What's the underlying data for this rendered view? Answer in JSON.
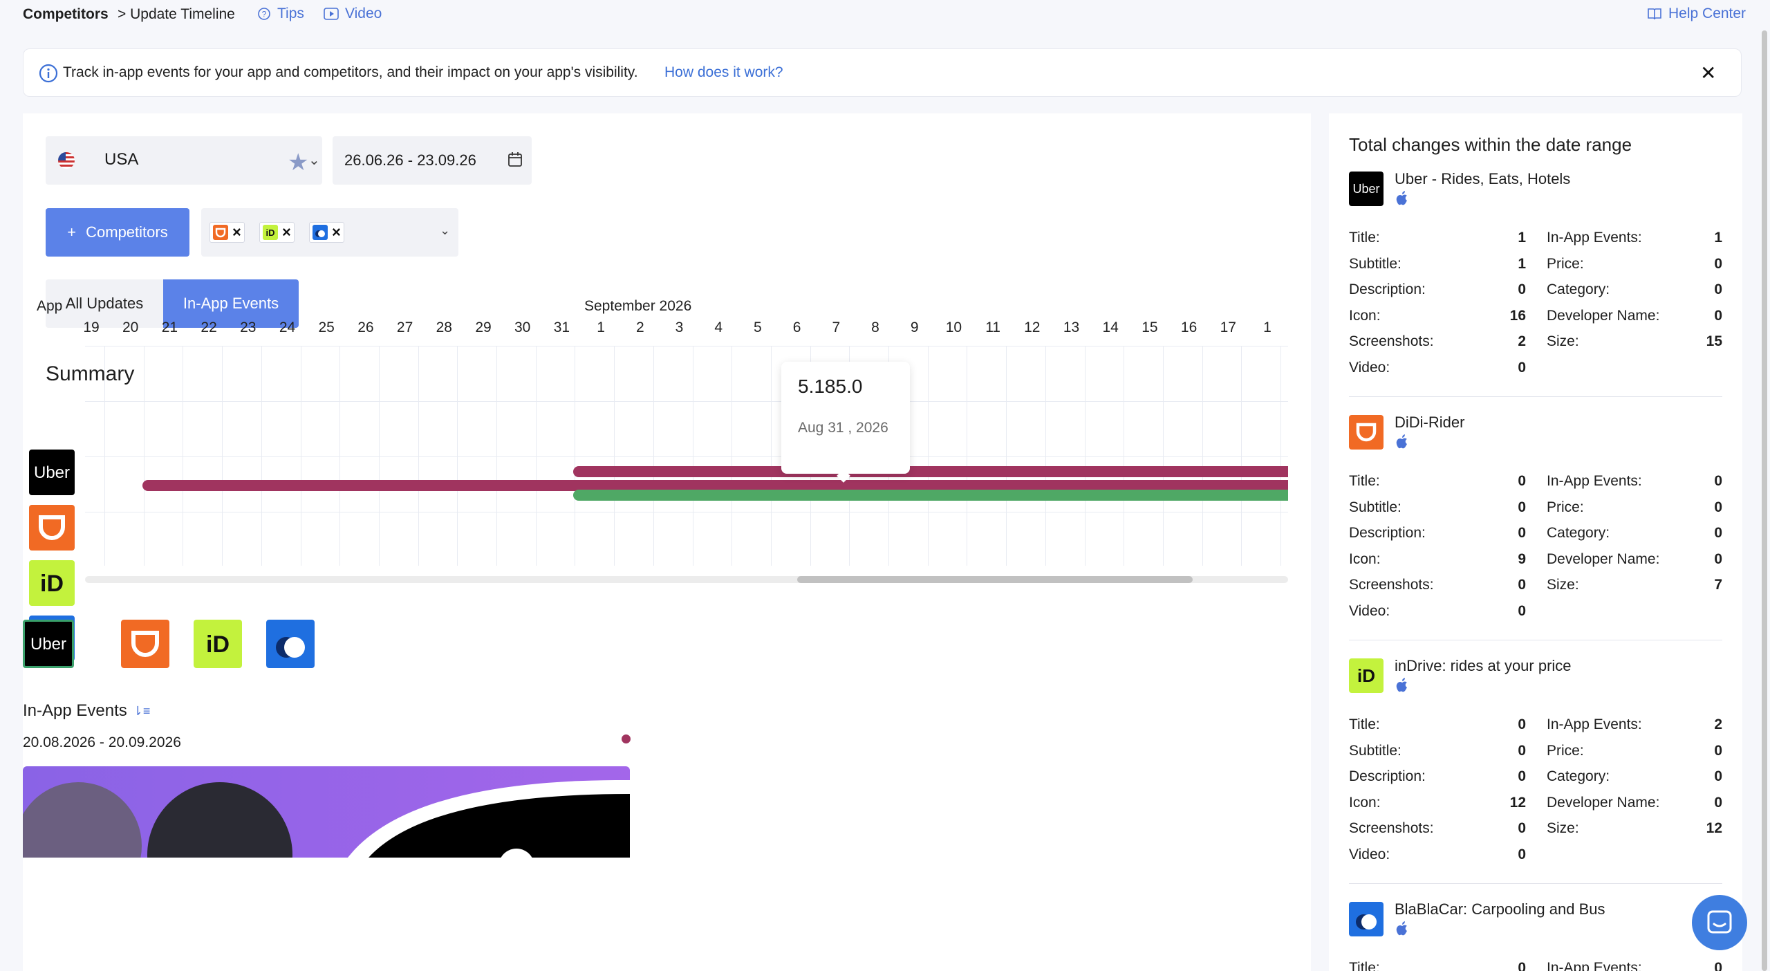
{
  "breadcrumb": {
    "root": "Competitors",
    "current": "> Update Timeline"
  },
  "links": {
    "tips": "Tips",
    "video": "Video",
    "help": "Help Center"
  },
  "banner": {
    "text": "Track in-app events for your app and competitors, and their impact on your app's visibility.",
    "link": "How does it work?",
    "close": "✕"
  },
  "filters": {
    "country": "USA",
    "date_range": "26.06.26 - 23.09.26",
    "competitors_button": "Competitors",
    "competitors_plus": "+"
  },
  "tabs": {
    "all": "All Updates",
    "inapp": "In-App Events",
    "active": "inapp"
  },
  "summary": {
    "title": "Summary",
    "app_label": "App",
    "month_label": "September 2026",
    "days": [
      "19",
      "20",
      "21",
      "22",
      "23",
      "24",
      "25",
      "26",
      "27",
      "28",
      "29",
      "30",
      "31",
      "1",
      "2",
      "3",
      "4",
      "5",
      "6",
      "7",
      "8",
      "9",
      "10",
      "11",
      "12",
      "13",
      "14",
      "15",
      "16",
      "17",
      "1"
    ],
    "tooltip": {
      "value": "5.185.0",
      "date": "Aug 31 , 2026"
    },
    "colors": {
      "update": "#a0345f",
      "event": "#4fa865"
    }
  },
  "inapp": {
    "title": "In-App Events",
    "range": "20.08.2026 - 20.09.2026"
  },
  "sidebar": {
    "title": "Total changes within the date range",
    "apps": [
      {
        "name": "Uber - Rides, Eats, Hotels",
        "icon": "uber-icon",
        "left": [
          [
            "Title:",
            "1"
          ],
          [
            "Subtitle:",
            "1"
          ],
          [
            "Description:",
            "0"
          ],
          [
            "Icon:",
            "16"
          ],
          [
            "Screenshots:",
            "2"
          ],
          [
            "Video:",
            "0"
          ]
        ],
        "right": [
          [
            "In-App Events:",
            "1"
          ],
          [
            "Price:",
            "0"
          ],
          [
            "Category:",
            "0"
          ],
          [
            "Developer Name:",
            "0"
          ],
          [
            "Size:",
            "15"
          ]
        ]
      },
      {
        "name": "DiDi-Rider",
        "icon": "didi-icon",
        "left": [
          [
            "Title:",
            "0"
          ],
          [
            "Subtitle:",
            "0"
          ],
          [
            "Description:",
            "0"
          ],
          [
            "Icon:",
            "9"
          ],
          [
            "Screenshots:",
            "0"
          ],
          [
            "Video:",
            "0"
          ]
        ],
        "right": [
          [
            "In-App Events:",
            "0"
          ],
          [
            "Price:",
            "0"
          ],
          [
            "Category:",
            "0"
          ],
          [
            "Developer Name:",
            "0"
          ],
          [
            "Size:",
            "7"
          ]
        ]
      },
      {
        "name": "inDrive: rides at your price",
        "icon": "indrive-icon",
        "left": [
          [
            "Title:",
            "0"
          ],
          [
            "Subtitle:",
            "0"
          ],
          [
            "Description:",
            "0"
          ],
          [
            "Icon:",
            "12"
          ],
          [
            "Screenshots:",
            "0"
          ],
          [
            "Video:",
            "0"
          ]
        ],
        "right": [
          [
            "In-App Events:",
            "2"
          ],
          [
            "Price:",
            "0"
          ],
          [
            "Category:",
            "0"
          ],
          [
            "Developer Name:",
            "0"
          ],
          [
            "Size:",
            "12"
          ]
        ]
      },
      {
        "name": "BlaBlaCar: Carpooling and Bus",
        "icon": "blablacar-icon",
        "left": [
          [
            "Title:",
            "0"
          ]
        ],
        "right": [
          [
            "In-App Events:",
            "0"
          ]
        ]
      }
    ]
  }
}
